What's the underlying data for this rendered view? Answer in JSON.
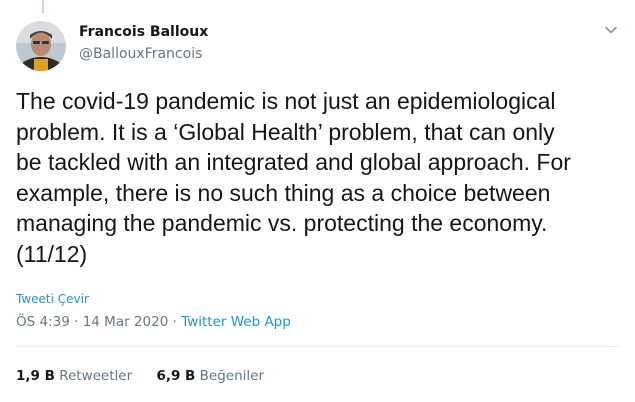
{
  "author": {
    "name": "Francois Balloux",
    "handle": "@BallouxFrancois"
  },
  "tweet": {
    "text": "The covid-19 pandemic is not just an epidemiological\nproblem. It is a ‘Global Health’ problem, that can only\nbe tackled with an integrated and global approach. For\nexample, there is no such thing as a choice between\nmanaging the pandemic vs. protecting the economy.\n(11/12)",
    "translate_label": "Tweeti Çevir",
    "time": "ÖS 4:39",
    "date": "14 Mar 2020",
    "separator": "·",
    "source": "Twitter Web App"
  },
  "stats": {
    "retweets_count": "1,9 B",
    "retweets_label": "Retweetler",
    "likes_count": "6,9 B",
    "likes_label": "Beğeniler"
  },
  "icons": {
    "menu": "chevron-down-icon",
    "avatar": "avatar"
  },
  "colors": {
    "link": "#1b95e0",
    "secondary_text": "#657786",
    "primary_text": "#14171a",
    "divider": "#e6ecf0"
  }
}
